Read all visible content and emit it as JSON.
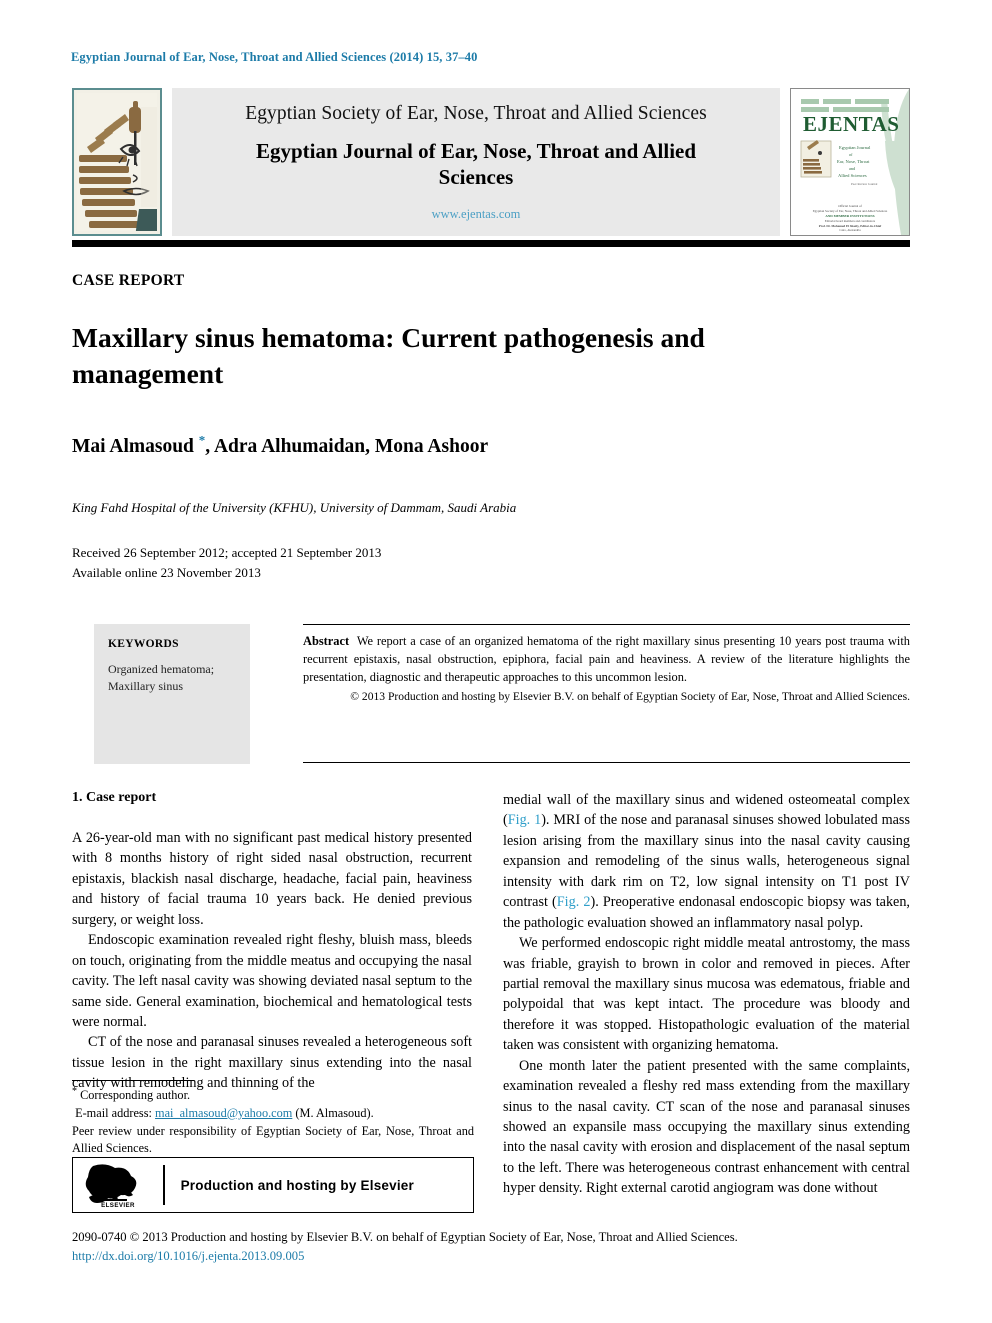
{
  "running_head": "Egyptian Journal of Ear, Nose, Throat and Allied Sciences (2014) 15, 37–40",
  "masthead": {
    "society_line": "Egyptian Society of Ear, Nose, Throat and Allied Sciences",
    "journal_title": "Egyptian Journal of Ear, Nose, Throat and Allied Sciences",
    "url": "www.ejentas.com",
    "cover_logo_text": "EJENTAS",
    "left_logo_alt": "sphinx-pharaoh-emblem"
  },
  "article": {
    "type": "CASE REPORT",
    "title": "Maxillary sinus hematoma: Current pathogenesis and management",
    "authors": "Mai Almasoud , Adra Alhumaidan, Mona Ashoor",
    "author_marker": "*",
    "affiliation": "King Fahd Hospital of the University (KFHU), University of Dammam, Saudi Arabia",
    "received": "Received 26 September 2012; accepted 21 September 2013",
    "available_online": "Available online 23 November 2013"
  },
  "keywords": {
    "heading": "KEYWORDS",
    "items": [
      "Organized hematoma;",
      "Maxillary sinus"
    ]
  },
  "abstract": {
    "label": "Abstract",
    "text": "We report a case of an organized hematoma of the right maxillary sinus presenting 10 years post trauma with recurrent epistaxis, nasal obstruction, epiphora, facial pain and heaviness. A review of the literature highlights the presentation, diagnostic and therapeutic approaches to this uncommon lesion.",
    "copyright": "© 2013 Production and hosting by Elsevier B.V. on behalf of Egyptian Society of Ear, Nose, Throat and Allied Sciences."
  },
  "body": {
    "section_heading": "1. Case report",
    "left_paragraphs": [
      "A 26-year-old man with no significant past medical history presented with 8 months history of right sided nasal obstruction, recurrent epistaxis, blackish nasal discharge, headache, facial pain, heaviness and history of facial trauma 10 years back. He denied previous surgery, or weight loss.",
      "Endoscopic examination revealed right fleshy, bluish mass, bleeds on touch, originating from the middle meatus and occupying the nasal cavity. The left nasal cavity was showing deviated nasal septum to the same side. General examination, biochemical and hematological tests were normal.",
      "CT of the nose and paranasal sinuses revealed a heterogeneous soft tissue lesion in the right maxillary sinus extending into the nasal cavity with remodeling and thinning of the"
    ],
    "right_paragraph_1_a": "medial wall of the maxillary sinus and widened osteomeatal complex (",
    "right_fig1": "Fig. 1",
    "right_paragraph_1_b": "). MRI of the nose and paranasal sinuses showed lobulated mass lesion arising from the maxillary sinus into the nasal cavity causing expansion and remodeling of the sinus walls, heterogeneous signal intensity with dark rim on T2, low signal intensity on T1 post IV contrast (",
    "right_fig2": "Fig. 2",
    "right_paragraph_1_c": "). Preoperative endonasal endoscopic biopsy was taken, the pathologic evaluation showed an inflammatory nasal polyp.",
    "right_paragraphs": [
      "We performed endoscopic right middle meatal antrostomy, the mass was friable, grayish to brown in color and removed in pieces. After partial removal the maxillary sinus mucosa was edematous, friable and polypoidal that was kept intact. The procedure was bloody and therefore it was stopped. Histopathologic evaluation of the material taken was consistent with organizing hematoma.",
      "One month later the patient presented with the same complaints, examination revealed a fleshy red mass extending from the maxillary sinus to the nasal cavity. CT scan of the nose and paranasal sinuses showed an expansile mass occupying the maxillary sinus extending into the nasal cavity with erosion and displacement of the nasal septum to the left. There was heterogeneous contrast enhancement with central hyper density. Right external carotid angiogram was done without"
    ]
  },
  "footnotes": {
    "corresponding": "Corresponding author.",
    "email_label": "E-mail address:",
    "email": "mai_almasoud@yahoo.com",
    "email_suffix": "(M. Almasoud).",
    "peer_review": "Peer review under responsibility of Egyptian Society of Ear, Nose, Throat and Allied Sciences."
  },
  "elsevier_badge": {
    "text": "Production and hosting by Elsevier",
    "brand": "ELSEVIER"
  },
  "colophon": {
    "line1": "2090-0740 © 2013 Production and hosting by Elsevier B.V. on behalf of Egyptian Society of Ear, Nose, Throat and Allied Sciences.",
    "doi": "http://dx.doi.org/10.1016/j.ejenta.2013.09.005"
  },
  "colors": {
    "link": "#1c7ba8",
    "figref": "#2e9ec9",
    "banner_bg": "#e9e9e9",
    "keyword_bg": "#e5e5e5",
    "sphinx_border": "#5b8d8f",
    "cover_green": "#2e6b3f"
  }
}
